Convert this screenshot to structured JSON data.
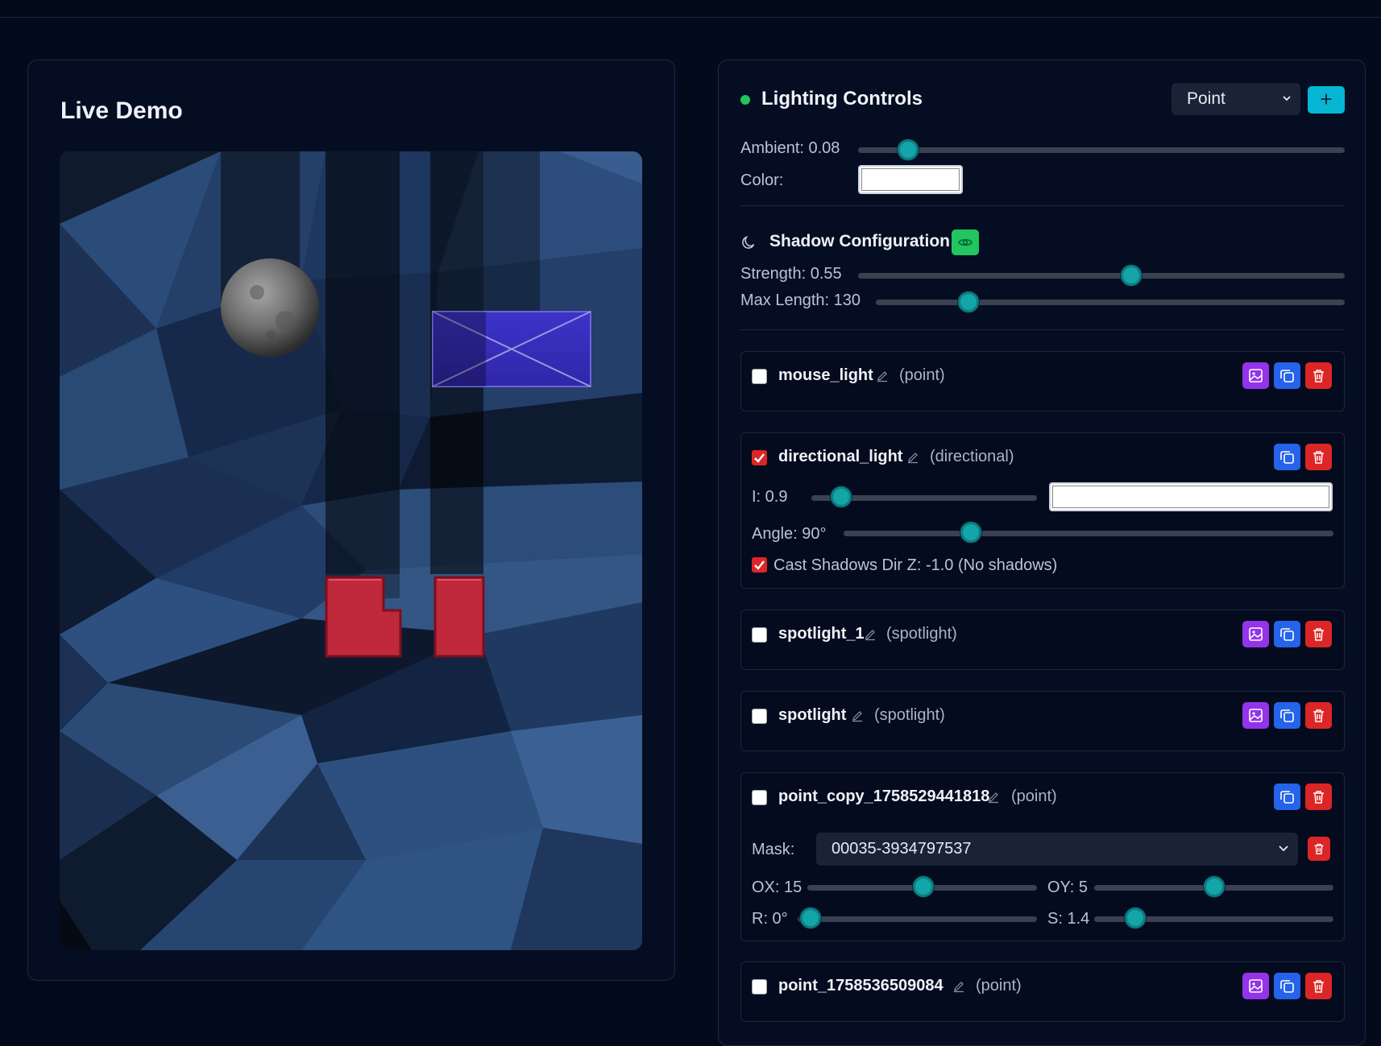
{
  "demo": {
    "title": "Live Demo"
  },
  "controls": {
    "title": "Lighting Controls",
    "type_select": "Point",
    "add_label": "+",
    "ambient_label": "Ambient: 0.08",
    "ambient_value": 0.08,
    "color_label": "Color:",
    "color_value": "#ffffff"
  },
  "shadow": {
    "title": "Shadow Configuration",
    "strength_label": "Strength: 0.55",
    "strength_value": 0.55,
    "maxlen_label": "Max Length: 130",
    "maxlen_value": 130
  },
  "lights": [
    {
      "name": "mouse_light",
      "type": "(point)",
      "checked": false,
      "buttons": [
        "image-icon",
        "copy-icon",
        "trash-icon"
      ]
    },
    {
      "name": "directional_light",
      "type": "(directional)",
      "checked": true,
      "buttons": [
        "copy-icon",
        "trash-icon"
      ],
      "intensity_label": "I: 0.9",
      "intensity_value": 0.9,
      "color_value": "#ffffff",
      "angle_label": "Angle: 90°",
      "angle_value": 90,
      "cast_label": "Cast Shadows Dir Z: -1.0 (No shadows)",
      "cast_checked": true
    },
    {
      "name": "spotlight_1",
      "type": "(spotlight)",
      "checked": false,
      "buttons": [
        "image-icon",
        "copy-icon",
        "trash-icon"
      ]
    },
    {
      "name": "spotlight",
      "type": "(spotlight)",
      "checked": false,
      "buttons": [
        "image-icon",
        "copy-icon",
        "trash-icon"
      ]
    },
    {
      "name": "point_copy_1758529441818",
      "type": "(point)",
      "checked": false,
      "buttons": [
        "copy-icon",
        "trash-icon"
      ],
      "mask_label": "Mask:",
      "mask_value": "00035-3934797537",
      "ox_label": "OX: 15",
      "ox_value": 15,
      "oy_label": "OY: 5",
      "oy_value": 5,
      "r_label": "R: 0°",
      "r_value": 0,
      "s_label": "S: 1.4",
      "s_value": 1.4
    },
    {
      "name": "point_1758536509084",
      "type": "(point)",
      "checked": false,
      "buttons": [
        "image-icon",
        "copy-icon",
        "trash-icon"
      ]
    }
  ],
  "colors": {
    "accent": "#06b6d4",
    "slider_thumb": "#14a5a8",
    "status": "#22c55e",
    "danger": "#dc2626",
    "copy": "#2563eb",
    "image": "#9333ea",
    "box_blue": "#3a2fc0",
    "block_red": "#c0283b"
  }
}
